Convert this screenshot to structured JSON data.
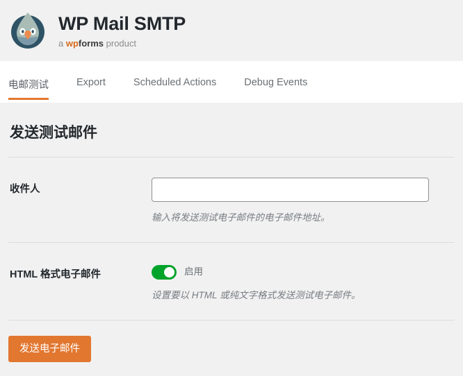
{
  "header": {
    "logo_icon": "wp-mail-smtp-bird-logo",
    "title": "WP Mail SMTP",
    "subtitle_prefix": "a ",
    "subtitle_brand_wp": "wp",
    "subtitle_brand_forms": "forms",
    "subtitle_suffix": " product"
  },
  "tabs": [
    {
      "label": "电邮测试",
      "active": true
    },
    {
      "label": "Export",
      "active": false
    },
    {
      "label": "Scheduled Actions",
      "active": false
    },
    {
      "label": "Debug Events",
      "active": false
    }
  ],
  "main": {
    "page_title": "发送测试邮件",
    "fields": [
      {
        "label": "收件人",
        "value": "",
        "placeholder": "",
        "description": "输入将发送测试电子邮件的电子邮件地址。"
      },
      {
        "label": "HTML 格式电子邮件",
        "toggle_state": "on",
        "toggle_label": "启用",
        "description": "设置要以 HTML 或纯文字格式发送测试电子邮件。"
      }
    ],
    "submit_label": "发送电子邮件"
  },
  "colors": {
    "accent_orange": "#e27730",
    "toggle_green": "#00a32a",
    "page_bg": "#f1f1f1",
    "tabbar_bg": "#ffffff",
    "divider": "#dcdcdc"
  }
}
